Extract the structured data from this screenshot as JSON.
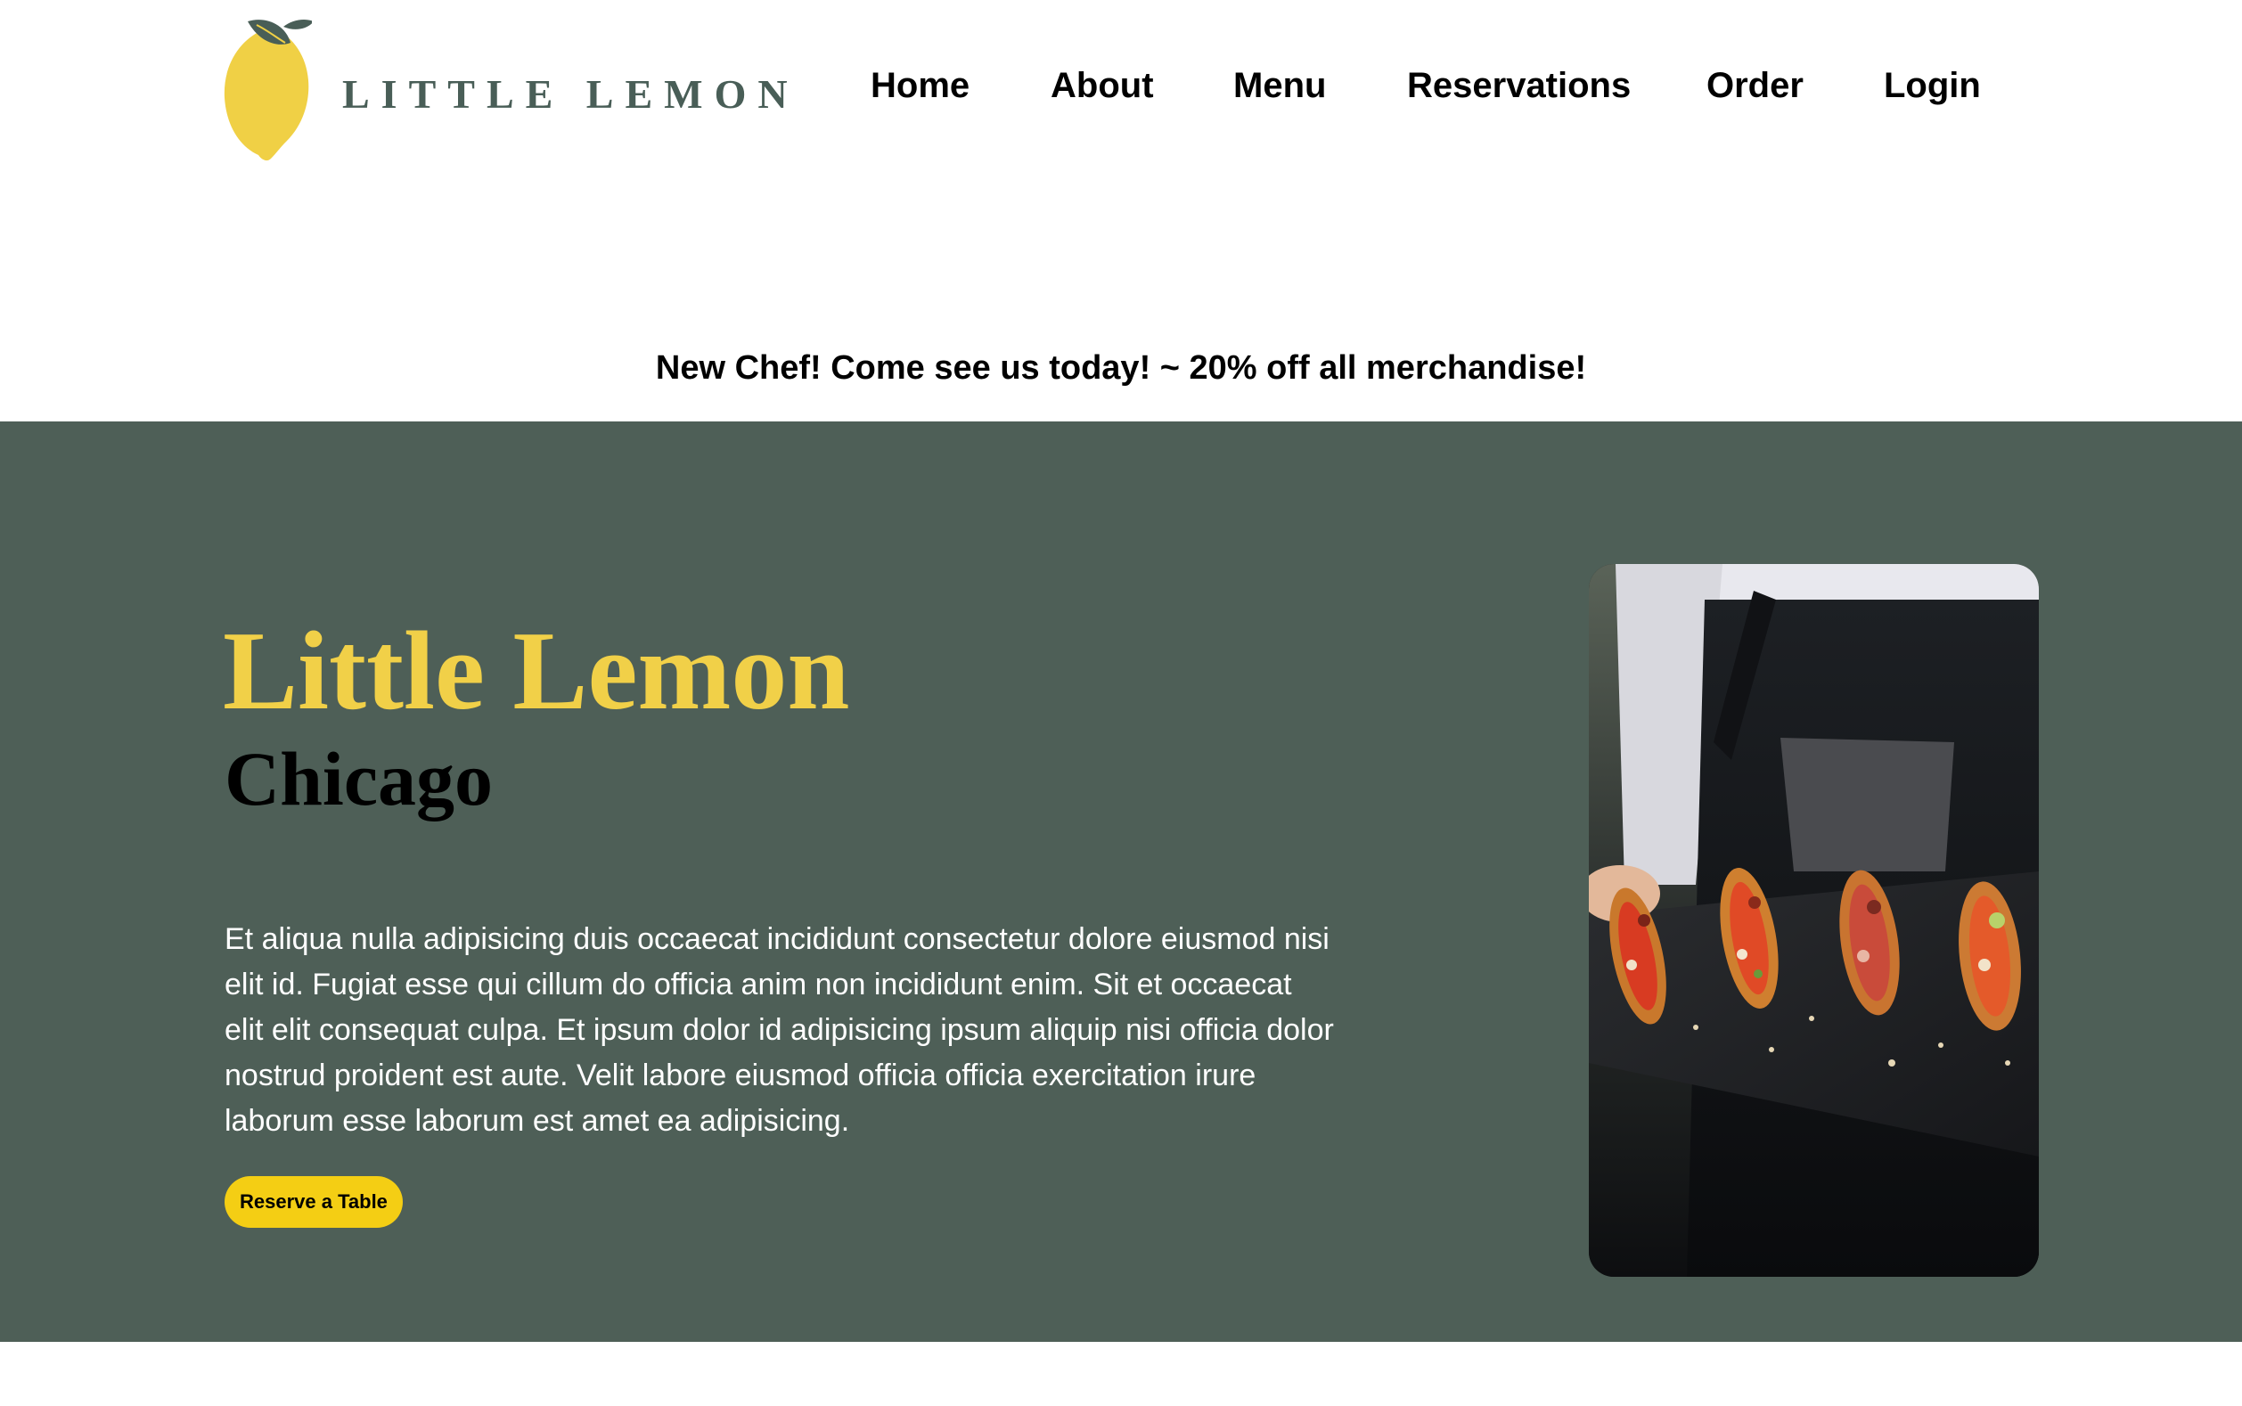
{
  "brand": {
    "name": "LITTLE LEMON",
    "logo_icon": "lemon-icon",
    "colors": {
      "lemon": "#F0D045",
      "leaf": "#495E57",
      "text": "#495E57"
    }
  },
  "nav": {
    "items": [
      {
        "label": "Home"
      },
      {
        "label": "About"
      },
      {
        "label": "Menu"
      },
      {
        "label": "Reservations"
      },
      {
        "label": "Order"
      },
      {
        "label": "Login"
      }
    ]
  },
  "promo": {
    "text": "New Chef! Come see us today! ~ 20% off all merchandise!"
  },
  "hero": {
    "title": "Little Lemon",
    "subtitle": "Chicago",
    "description": "Et aliqua nulla adipisicing duis occaecat incididunt consectetur dolore eiusmod nisi elit id. Fugiat esse qui cillum do officia anim non incididunt enim. Sit et occaecat elit elit consequat culpa. Et ipsum dolor id adipisicing ipsum aliquip nisi officia dolor nostrud proident est aute. Velit labore eiusmod officia officia exercitation irure laborum esse laborum est amet ea adipisicing.",
    "cta_label": "Reserve a Table",
    "image_icon": "food-platter-photo",
    "colors": {
      "background": "#4E5F57",
      "title": "#F1D048",
      "button": "#F4CE14"
    }
  }
}
